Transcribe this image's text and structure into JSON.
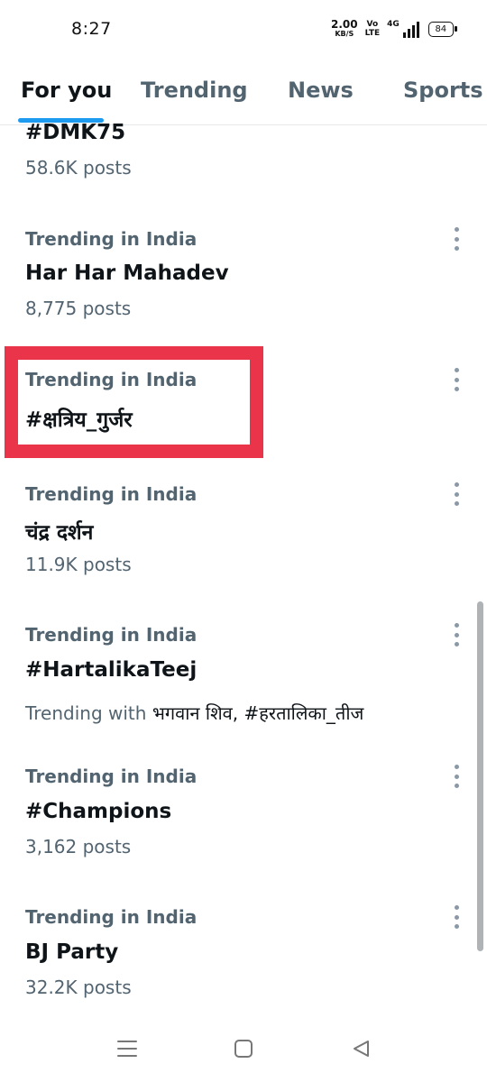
{
  "status_bar": {
    "time": "8:27",
    "net_speed_value": "2.00",
    "net_speed_unit": "KB/S",
    "volte_top": "Vo",
    "volte_bottom": "LTE",
    "network_type": "4G",
    "battery": "84",
    "icons": [
      "net-speed",
      "volte-icon",
      "signal-icon",
      "battery-icon"
    ]
  },
  "tabs": [
    {
      "label": "For you",
      "active": true
    },
    {
      "label": "Trending",
      "active": false
    },
    {
      "label": "News",
      "active": false
    },
    {
      "label": "Sports",
      "active": false
    }
  ],
  "trends": [
    {
      "meta": "",
      "title": "#DMK75",
      "sub": "58.6K posts"
    },
    {
      "meta": "Trending in India",
      "title": "Har Har Mahadev",
      "sub": "8,775 posts"
    },
    {
      "meta": "Trending in India",
      "title": "#क्षत्रिय_गुर्जर",
      "sub": ""
    },
    {
      "meta": "Trending in India",
      "title": "चंद्र दर्शन",
      "sub": "11.9K posts"
    },
    {
      "meta": "Trending in India",
      "title": "#HartalikaTeej",
      "sub_prefix": "Trending with",
      "sub_highlight": "भगवान शिव, #हरतालिका_तीज"
    },
    {
      "meta": "Trending in India",
      "title": "#Champions",
      "sub": "3,162 posts"
    },
    {
      "meta": "Trending in India",
      "title": "BJ Party",
      "sub": "32.2K posts"
    }
  ],
  "colors": {
    "accent": "#1d9bf0",
    "highlight_box": "#e9344a",
    "secondary_text": "#536471",
    "primary_text": "#0f1419"
  },
  "nav_icons": [
    "menu-icon",
    "home-square-icon",
    "back-triangle-icon"
  ]
}
